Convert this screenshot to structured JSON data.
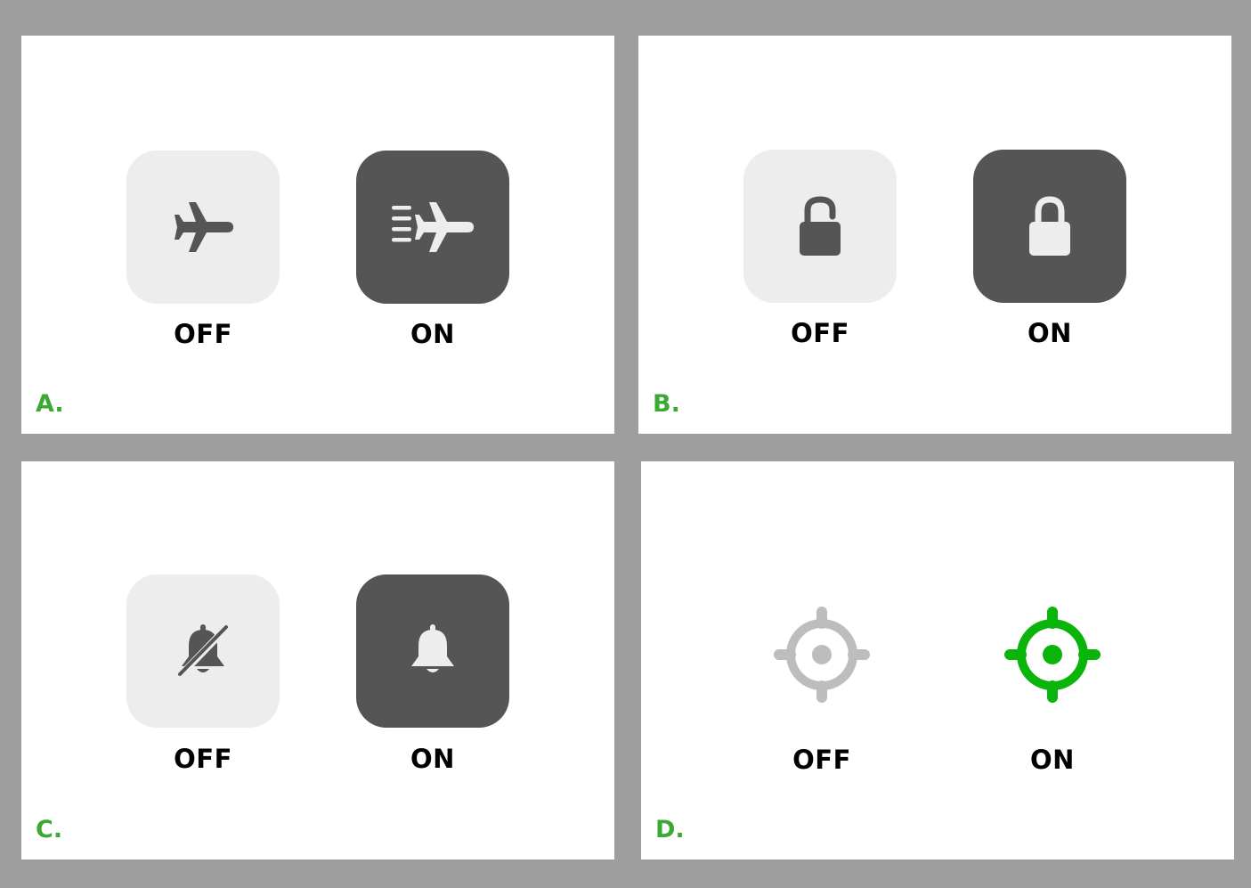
{
  "colors": {
    "frame": "#9e9e9e",
    "panel": "#ffffff",
    "tile_off": "#ededed",
    "tile_on": "#555555",
    "icon_off": "#555555",
    "icon_on": "#ededed",
    "letter": "#3aaa35",
    "location_off": "#bdbdbd",
    "location_on": "#0ab40a"
  },
  "panels": [
    {
      "letter": "A.",
      "off": {
        "label": "OFF",
        "icon": "airplane-icon"
      },
      "on": {
        "label": "ON",
        "icon": "airplane-speed-icon"
      }
    },
    {
      "letter": "B.",
      "off": {
        "label": "OFF",
        "icon": "unlock-icon"
      },
      "on": {
        "label": "ON",
        "icon": "lock-icon"
      }
    },
    {
      "letter": "C.",
      "off": {
        "label": "OFF",
        "icon": "bell-slash-icon"
      },
      "on": {
        "label": "ON",
        "icon": "bell-icon"
      }
    },
    {
      "letter": "D.",
      "off": {
        "label": "OFF",
        "icon": "location-target-icon"
      },
      "on": {
        "label": "ON",
        "icon": "location-target-icon"
      }
    }
  ]
}
